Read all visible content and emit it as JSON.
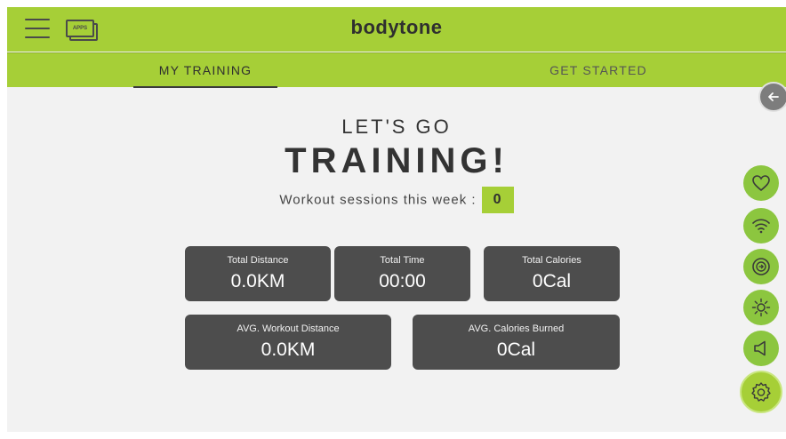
{
  "header": {
    "logo": "bodytone",
    "apps_label": "APPS"
  },
  "tabs": [
    {
      "label": "MY TRAINING",
      "active": true
    },
    {
      "label": "GET STARTED",
      "active": false
    }
  ],
  "main": {
    "headline_top": "LET'S GO",
    "headline_main": "TRAINING!",
    "sessions_label": "Workout sessions this week :",
    "sessions_count": "0"
  },
  "stats": [
    {
      "title": "Total Distance",
      "value": "0.0KM"
    },
    {
      "title": "Total Time",
      "value": "00:00"
    },
    {
      "title": "Total Calories",
      "value": "0Cal"
    },
    {
      "title": "AVG. Workout Distance",
      "value": "0.0KM"
    },
    {
      "title": "AVG. Calories Burned",
      "value": "0Cal"
    }
  ],
  "side_buttons": [
    "heart-icon",
    "wifi-icon",
    "speed-icon",
    "brightness-icon",
    "volume-icon",
    "gear-icon"
  ],
  "colors": {
    "accent": "#a6cf37",
    "card": "#4d4d4d",
    "background": "#f2f2f2"
  }
}
